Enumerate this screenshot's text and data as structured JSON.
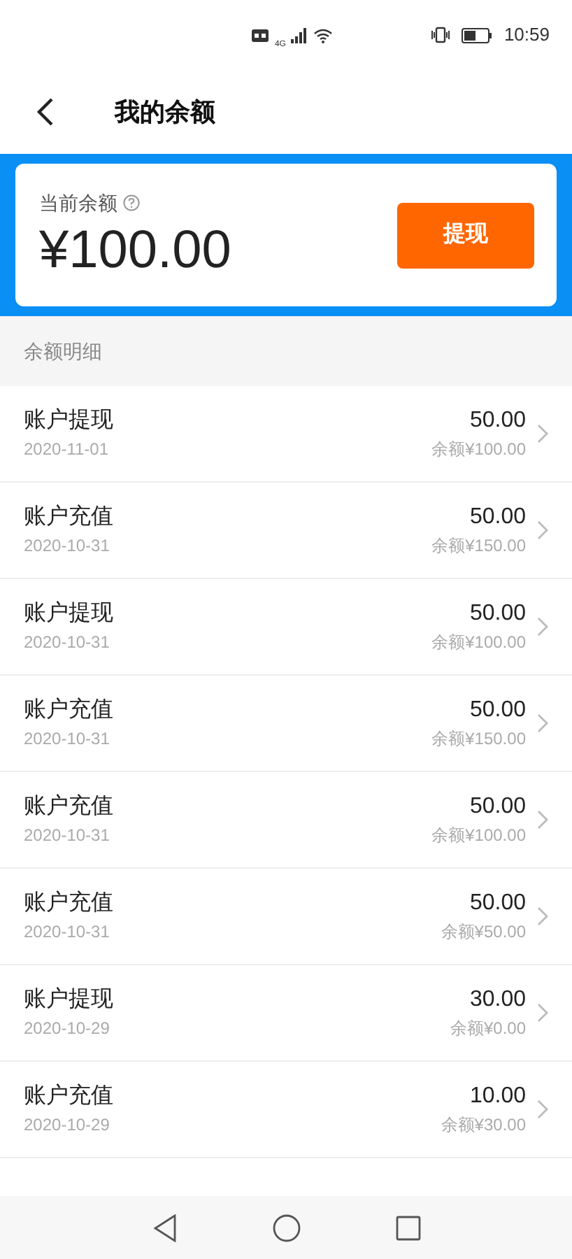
{
  "status_bar": {
    "time": "10:59",
    "network": "4G"
  },
  "header": {
    "title": "我的余额"
  },
  "balance_card": {
    "label": "当前余额",
    "amount": "¥100.00",
    "button": "提现"
  },
  "section_title": "余额明细",
  "transactions": [
    {
      "title": "账户提现",
      "date": "2020-11-01",
      "amount": "50.00",
      "balance": "余额¥100.00"
    },
    {
      "title": "账户充值",
      "date": "2020-10-31",
      "amount": "50.00",
      "balance": "余额¥150.00"
    },
    {
      "title": "账户提现",
      "date": "2020-10-31",
      "amount": "50.00",
      "balance": "余额¥100.00"
    },
    {
      "title": "账户充值",
      "date": "2020-10-31",
      "amount": "50.00",
      "balance": "余额¥150.00"
    },
    {
      "title": "账户充值",
      "date": "2020-10-31",
      "amount": "50.00",
      "balance": "余额¥100.00"
    },
    {
      "title": "账户充值",
      "date": "2020-10-31",
      "amount": "50.00",
      "balance": "余额¥50.00"
    },
    {
      "title": "账户提现",
      "date": "2020-10-29",
      "amount": "30.00",
      "balance": "余额¥0.00"
    },
    {
      "title": "账户充值",
      "date": "2020-10-29",
      "amount": "10.00",
      "balance": "余额¥30.00"
    }
  ]
}
